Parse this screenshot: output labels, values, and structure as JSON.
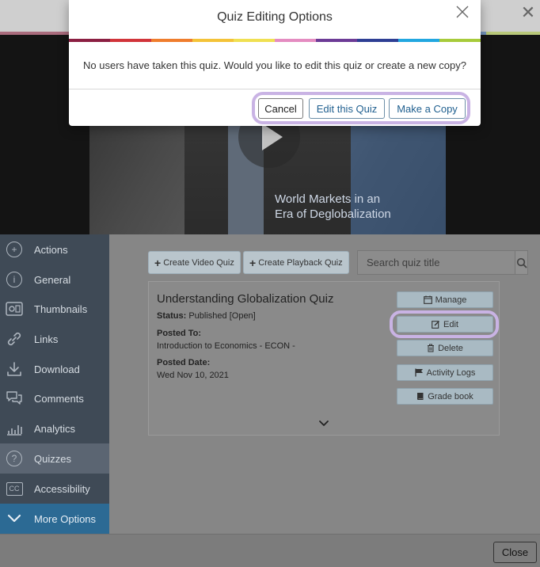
{
  "video": {
    "caption_line1": "World Markets in an",
    "caption_line2": "Era of Deglobalization"
  },
  "sidebar": {
    "items": [
      {
        "label": "Actions",
        "icon": "plus-circle-icon"
      },
      {
        "label": "General",
        "icon": "info-icon"
      },
      {
        "label": "Thumbnails",
        "icon": "thumbnails-icon"
      },
      {
        "label": "Links",
        "icon": "link-icon"
      },
      {
        "label": "Download",
        "icon": "download-icon"
      },
      {
        "label": "Comments",
        "icon": "comments-icon"
      },
      {
        "label": "Analytics",
        "icon": "analytics-icon"
      },
      {
        "label": "Quizzes",
        "icon": "question-icon"
      },
      {
        "label": "Accessibility",
        "icon": "cc-icon"
      },
      {
        "label": "More Options",
        "icon": "chevron-down-icon"
      }
    ],
    "active": "Quizzes"
  },
  "toolbar": {
    "create_video_quiz": "Create Video Quiz",
    "create_playback_quiz": "Create Playback Quiz",
    "search_placeholder": "Search quiz title"
  },
  "quiz": {
    "title": "Understanding Globalization Quiz",
    "status_label": "Status:",
    "status_value": "Published [Open]",
    "posted_to_label": "Posted To:",
    "posted_to_value": "Introduction to Economics - ECON -",
    "posted_date_label": "Posted Date:",
    "posted_date_value": "Wed Nov 10, 2021",
    "buttons": {
      "manage": "Manage",
      "edit": "Edit",
      "delete": "Delete",
      "activity_logs": "Activity Logs",
      "grade_book": "Grade book"
    }
  },
  "footer": {
    "close_label": "Close"
  },
  "modal": {
    "title": "Quiz Editing Options",
    "message": "No users have taken this quiz. Would you like to edit this quiz or create a new copy?",
    "cancel_label": "Cancel",
    "edit_label": "Edit this Quiz",
    "copy_label": "Make a Copy",
    "rainbow_colors": [
      "#8b1f42",
      "#d1343a",
      "#ef7d2d",
      "#f4c338",
      "#f0e052",
      "#e48cc1",
      "#6c3b96",
      "#2e3f94",
      "#22a7e0",
      "#a7cb3b"
    ]
  },
  "colors": {
    "highlight": "#c9b3e4",
    "primary_text": "#1f5f8f"
  }
}
